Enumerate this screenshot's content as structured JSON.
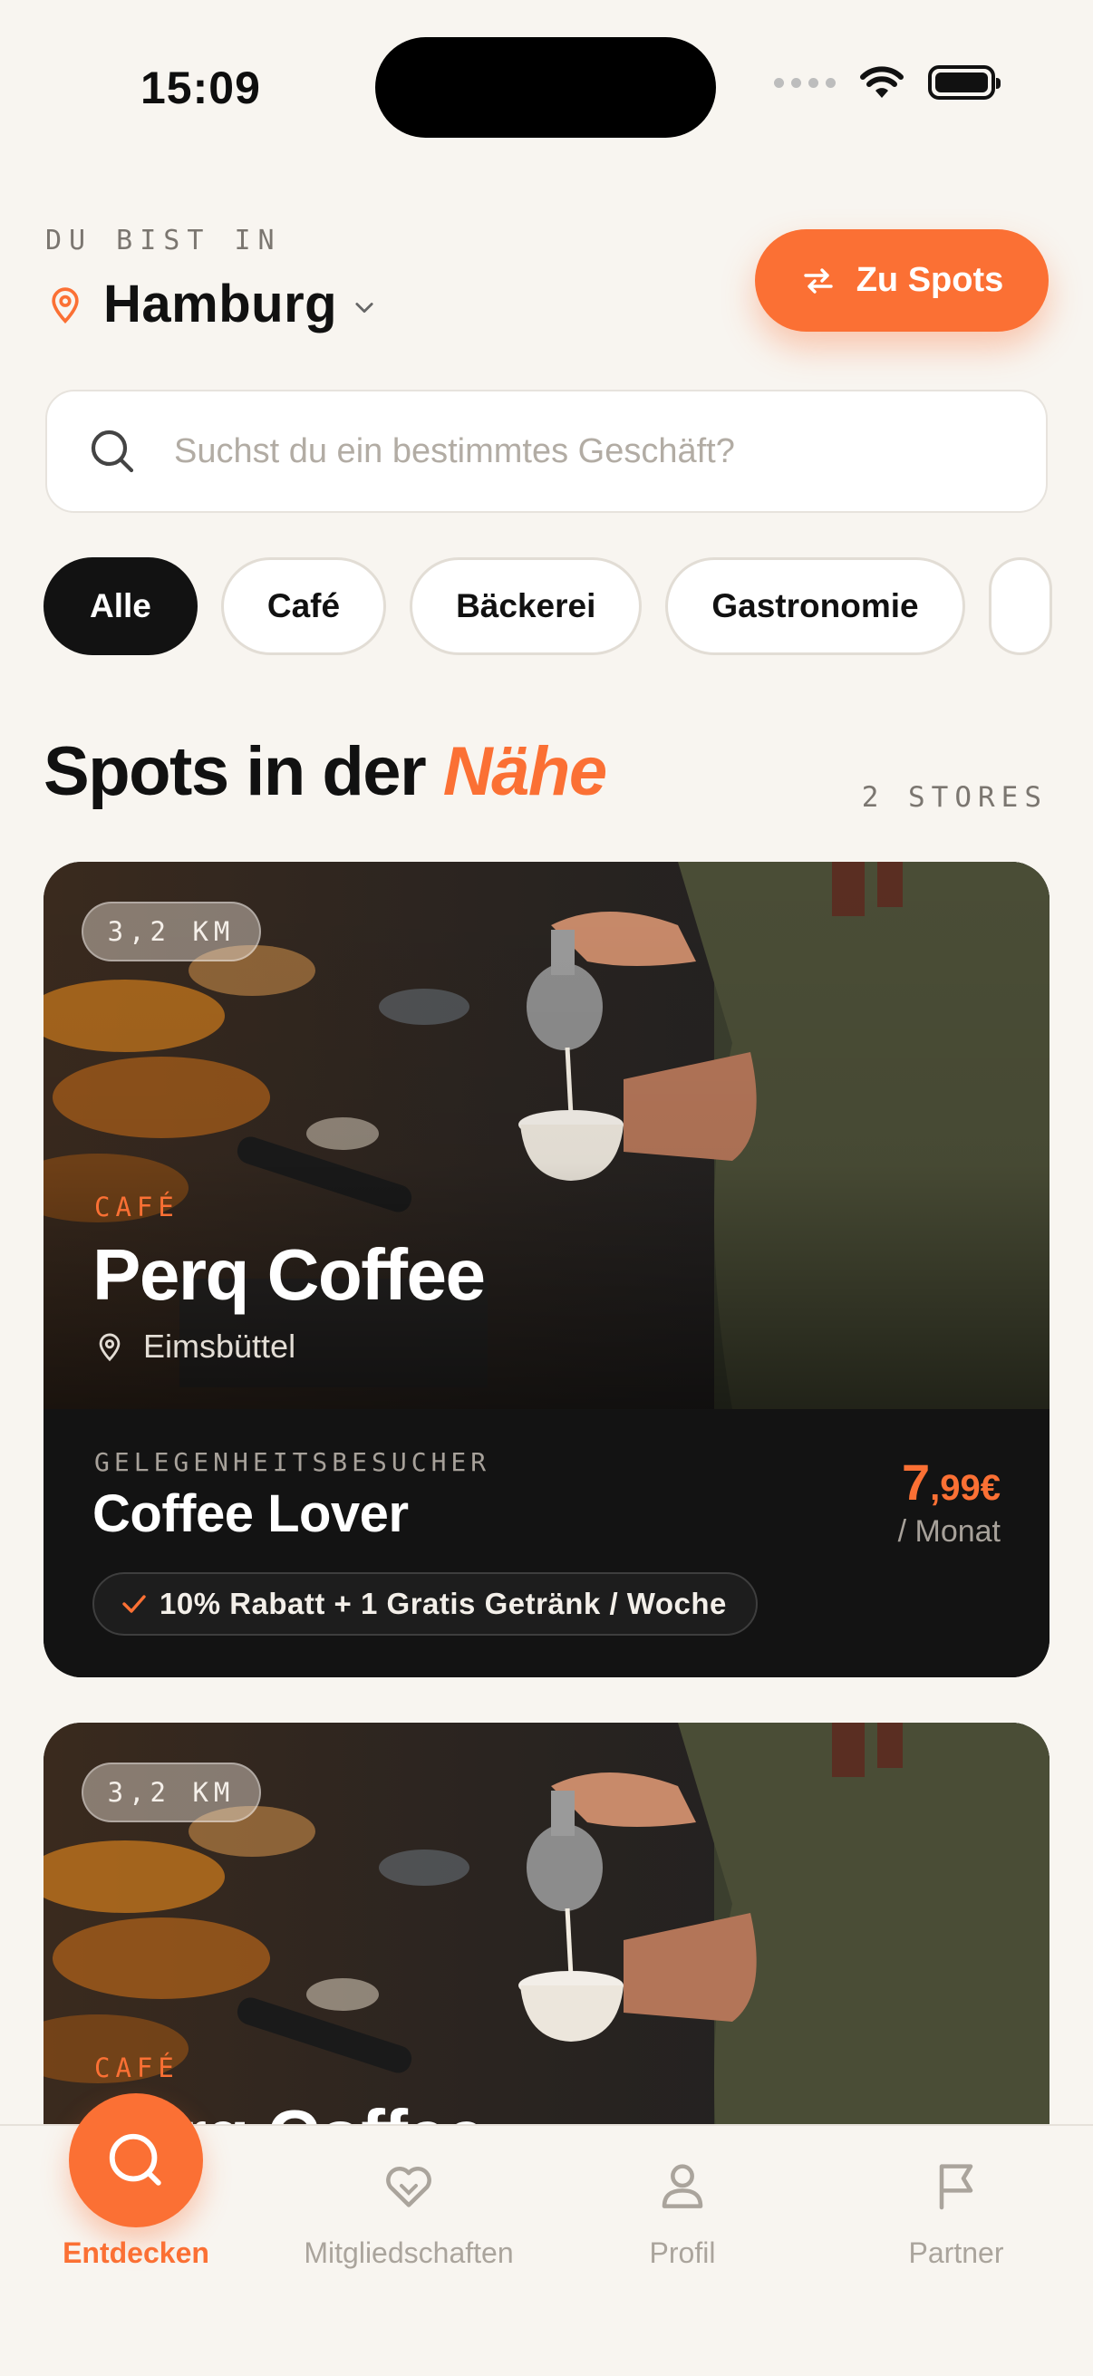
{
  "status_bar": {
    "time": "15:09"
  },
  "header": {
    "eyebrow": "DU BIST IN",
    "city": "Hamburg",
    "cta_label": "Zu Spots"
  },
  "search": {
    "placeholder": "Suchst du ein bestimmtes Geschäft?"
  },
  "filters": {
    "chips": [
      "Alle",
      "Café",
      "Bäckerei",
      "Gastronomie"
    ],
    "selected": "Alle"
  },
  "section": {
    "title_prefix": "Spots in der",
    "title_highlight": "Nähe",
    "count": "2 STORES"
  },
  "spots": [
    {
      "distance": "3,2 KM",
      "category": "CAFÉ",
      "name": "Perq Coffee",
      "location": "Eimsbüttel",
      "tier_label": "GELEGENHEITSBESUCHER",
      "tier_name": "Coffee Lover",
      "price_main": "7",
      "price_cents": ",99€",
      "price_period": "/ Monat",
      "perk": "10% Rabatt + 1 Gratis Getränk / Woche"
    },
    {
      "distance": "3,2 KM",
      "category": "CAFÉ",
      "name": "Perq Coffee"
    }
  ],
  "tabbar": {
    "items": [
      {
        "label": "Entdecken",
        "icon": "search-icon",
        "active": true
      },
      {
        "label": "Mitgliedschaften",
        "icon": "heart-icon",
        "active": false
      },
      {
        "label": "Profil",
        "icon": "user-icon",
        "active": false
      },
      {
        "label": "Partner",
        "icon": "flag-icon",
        "active": false
      }
    ]
  },
  "colors": {
    "accent": "#fb7034",
    "background": "#f8f5f0",
    "dark": "#121212"
  }
}
